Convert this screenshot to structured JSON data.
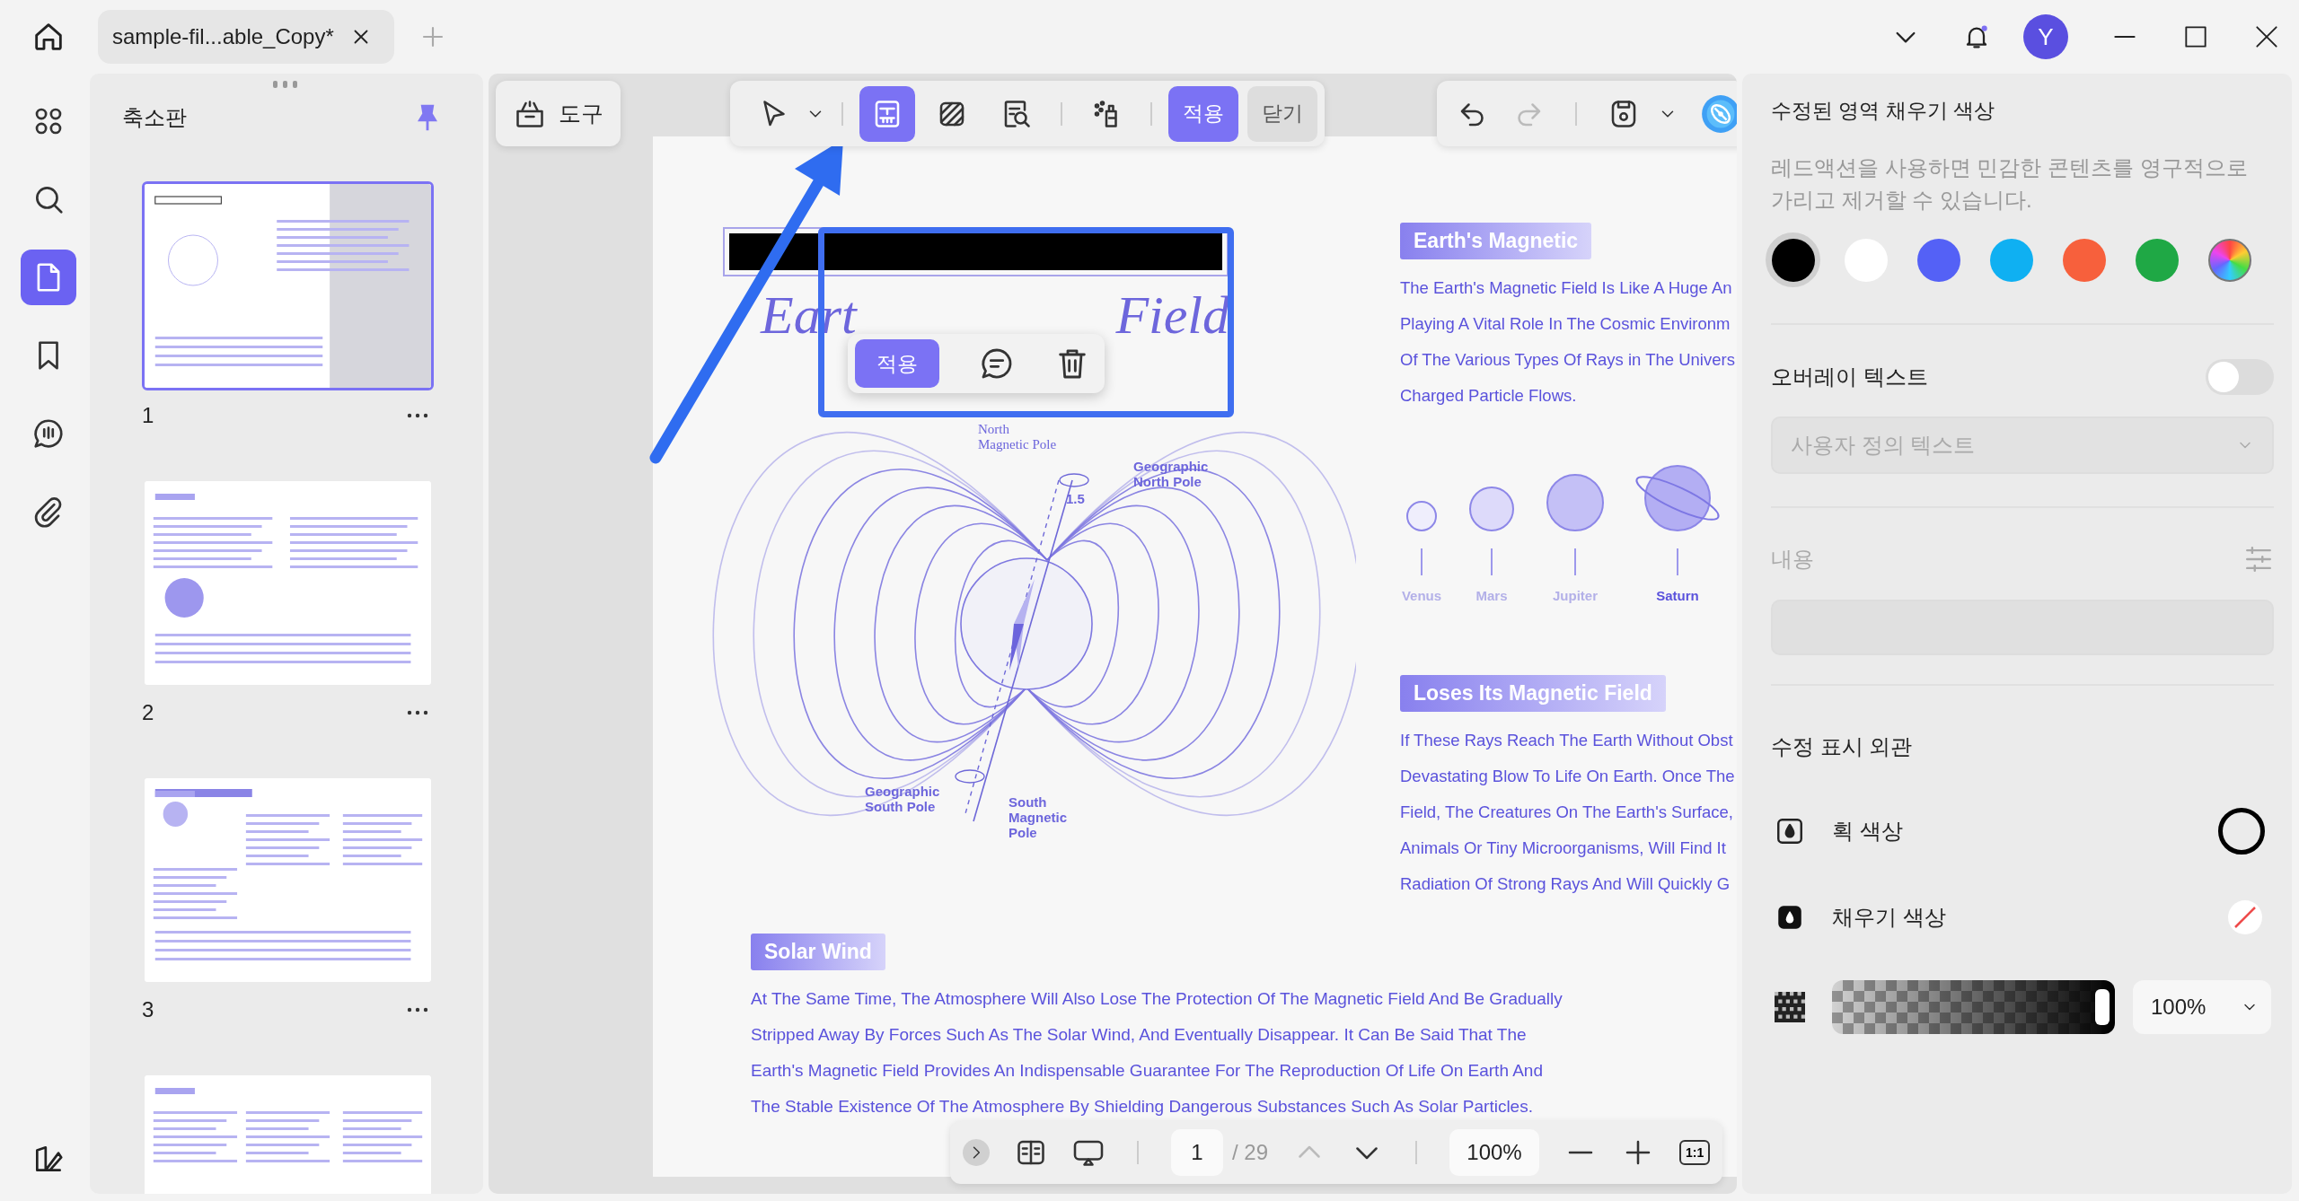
{
  "title_bar": {
    "tab": {
      "label": "sample-fil...able_Copy*"
    },
    "bell_unread": true,
    "avatar": "Y"
  },
  "rail": {
    "items": [
      {
        "kind": "grid",
        "selected": false
      },
      {
        "kind": "search",
        "selected": false
      },
      {
        "kind": "page",
        "selected": true
      },
      {
        "kind": "bookmark",
        "selected": false
      },
      {
        "kind": "comment",
        "selected": false
      },
      {
        "kind": "attachment",
        "selected": false
      }
    ],
    "bottom": {
      "kind": "layers"
    }
  },
  "thumbnails": {
    "title": "축소판",
    "pages": [
      {
        "number": "1",
        "selected": true
      },
      {
        "number": "2",
        "selected": false
      },
      {
        "number": "3",
        "selected": false
      },
      {
        "selected": false
      }
    ]
  },
  "toolbar": {
    "tools_button": "도구",
    "tools": [
      {
        "kind": "select",
        "selected": false
      },
      {
        "kind": "area",
        "selected": true
      },
      {
        "kind": "pattern",
        "selected": false
      },
      {
        "kind": "search",
        "selected": false
      },
      {
        "kind": "spray",
        "selected": false
      }
    ],
    "apply": "적용",
    "close": "닫기",
    "history": [
      {
        "kind": "undo",
        "disabled": false
      },
      {
        "kind": "redo",
        "disabled": true
      }
    ]
  },
  "document": {
    "title_parts": [
      "Eart",
      "Field"
    ],
    "diagram_labels": [
      {
        "kind": "serif",
        "lines": [
          "North",
          "Magnetic Pole"
        ]
      },
      {
        "kind": "sans",
        "lines": [
          "Geographic",
          "North Pole"
        ]
      },
      {
        "kind": "sans",
        "lines": [
          "1.5"
        ]
      },
      {
        "kind": "sans",
        "lines": [
          "Geographic",
          "South Pole"
        ]
      },
      {
        "kind": "sans",
        "lines": [
          "South",
          "Magnetic",
          "Pole"
        ]
      }
    ],
    "sections": [
      {
        "heading": "Earth's Magnetic",
        "lines": [
          "The Earth's Magnetic Field Is Like A Huge An",
          "Playing A Vital Role In The Cosmic Environm",
          "Of The Various Types Of Rays in The Univers",
          "Charged Particle Flows."
        ]
      },
      {
        "heading": "Loses Its Magnetic Field",
        "lines": [
          "If These Rays Reach The Earth Without Obst",
          "Devastating Blow To Life On Earth. Once The",
          "Field, The Creatures On The Earth's Surface,",
          "Animals Or Tiny Microorganisms, Will Find It",
          "Radiation Of Strong Rays And Will Quickly G"
        ]
      }
    ],
    "planets": [
      {
        "name": "Venus",
        "ringed": false,
        "highlighted": false
      },
      {
        "name": "Mars",
        "ringed": false,
        "highlighted": false
      },
      {
        "name": "Jupiter",
        "ringed": false,
        "highlighted": false
      },
      {
        "name": "Saturn",
        "ringed": true,
        "highlighted": true
      }
    ],
    "solar_wind": {
      "heading": "Solar Wind",
      "lines": [
        "At The Same Time, The Atmosphere Will Also Lose The Protection Of The Magnetic Field And Be Gradually",
        "Stripped Away By Forces Such As The Solar Wind, And Eventually Disappear. It Can Be Said That The",
        "Earth's Magnetic Field Provides An Indispensable Guarantee For The Reproduction Of Life On Earth And",
        "The Stable Existence Of The Atmosphere By Shielding Dangerous Substances Such As Solar Particles."
      ]
    }
  },
  "popup": {
    "apply": "적용"
  },
  "page_nav": {
    "page": "1",
    "total": "/ 29",
    "prev_disabled": true,
    "zoom": "100%",
    "fit": "1:1"
  },
  "panel": {
    "title": "수정된 영역 채우기 색상",
    "description": "레드액션을 사용하면 민감한 콘텐츠를 영구적으로 가리고 제거할 수 있습니다.",
    "swatches": [
      {
        "kind": "solid",
        "color": "#000000",
        "selected": true
      },
      {
        "kind": "solid",
        "color": "#ffffff",
        "selected": false
      },
      {
        "kind": "solid",
        "color": "#5461f6",
        "selected": false
      },
      {
        "kind": "solid",
        "color": "#0fb0f2",
        "selected": false
      },
      {
        "kind": "solid",
        "color": "#f7603c",
        "selected": false
      },
      {
        "kind": "solid",
        "color": "#1fa845",
        "selected": false
      },
      {
        "kind": "spectrum",
        "selected": false
      }
    ],
    "overlay": {
      "label": "오버레이 텍스트",
      "on": false,
      "placeholder": "사용자 정의 텍스트"
    },
    "content": {
      "label": "내용",
      "disabled": true
    },
    "appearance": {
      "title": "수정 표시 외관",
      "stroke": {
        "label": "획 색상",
        "color": "#000000"
      },
      "fill": {
        "label": "채우기 색상"
      },
      "opacity": {
        "level": 1,
        "value": "100%"
      }
    }
  }
}
